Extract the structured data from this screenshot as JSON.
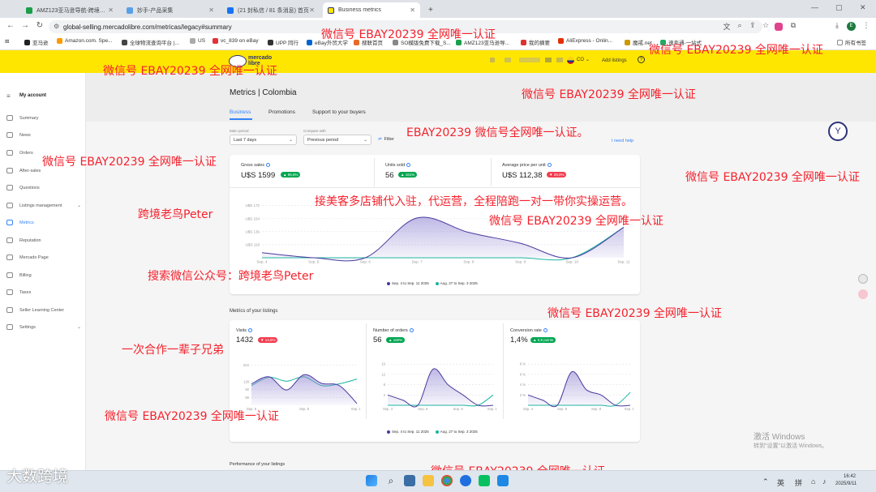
{
  "browser": {
    "tabs": [
      {
        "title": "AMZ123亚马逊导航-跨境电商",
        "color": "#1a9f4a"
      },
      {
        "title": "妙手-产品采集",
        "color": "#5aa0e8"
      },
      {
        "title": "(21 封私信 / 81 条消息) 首页",
        "color": "#1772f6"
      },
      {
        "title": "Business metrics",
        "color": "#ffe600"
      }
    ],
    "new_tab": "+",
    "url": "global-selling.mercadolibre.com/metricas/legacy#summary",
    "bookmarks": [
      "亚马逊",
      "Amazon.com. Spe...",
      "全球物流查询平台 |...",
      "US",
      "vc_839 on eBay",
      "UPP 同行",
      "eBay外贸大学",
      "搜联首页",
      "SO模版免费下载_S...",
      "AMZ123亚马逊导...",
      "我的摘要",
      "AliExpress - Onlin...",
      "魔戒.net",
      "速卖通-一站式"
    ],
    "bookmarks_right": "所有书签"
  },
  "header": {
    "logo_line1": "mercado",
    "logo_line2": "libre",
    "country": "CO",
    "add_listings": "Add listings"
  },
  "sidebar": {
    "title": "My account",
    "items": [
      {
        "label": "Summary"
      },
      {
        "label": "News"
      },
      {
        "label": "Orders"
      },
      {
        "label": "After-sales"
      },
      {
        "label": "Questions"
      },
      {
        "label": "Listings management"
      },
      {
        "label": "Metrics"
      },
      {
        "label": "Reputation"
      },
      {
        "label": "Mercado Page"
      },
      {
        "label": "Billing"
      },
      {
        "label": "Taxes"
      },
      {
        "label": "Seller Learning Center"
      },
      {
        "label": "Settings"
      }
    ]
  },
  "page": {
    "title": "Metrics | Colombia",
    "tabs": [
      "Business",
      "Promotions",
      "Support to your buyers"
    ]
  },
  "filters": {
    "main_period_label": "Main period",
    "main_period_value": "Last 7 days",
    "compare_label": "Compare with",
    "compare_value": "Previous period",
    "filter_label": "Filter",
    "need_help": "I need help"
  },
  "kpis": [
    {
      "label": "Gross sales",
      "value": "U$S 1599",
      "change": "▲ 86,8%",
      "direction": "up"
    },
    {
      "label": "Units sold",
      "value": "56",
      "change": "▲ 161%",
      "direction": "up"
    },
    {
      "label": "Average price per unit",
      "value": "U$S 112,38",
      "change": "▼ 29,0%",
      "direction": "down"
    }
  ],
  "listings": {
    "section_title": "Metrics of your listings",
    "cards": [
      {
        "label": "Visits",
        "value": "1432",
        "change": "▼ 14,5%",
        "direction": "down"
      },
      {
        "label": "Number of orders",
        "value": "56",
        "change": "▲ 160%",
        "direction": "up"
      },
      {
        "label": "Conversion rate",
        "value": "1,4%",
        "change": "▲ 0,8 points",
        "direction": "up"
      }
    ]
  },
  "performance_title": "Performance of your listings",
  "chart_data": [
    {
      "type": "area",
      "x": [
        "Sep. 4",
        "Sep. 5",
        "Sep. 6",
        "Sep. 7",
        "Sep. 8",
        "Sep. 9",
        "Sep. 10",
        "Sep. 11"
      ],
      "y_ticks": [
        "U$S 172",
        "U$S 154",
        "U$S 136",
        "U$S 118"
      ],
      "ylim": [
        100,
        175
      ],
      "series": [
        {
          "name": "Sep. 4 to Sep. 11 2025",
          "color": "#4a3a9e",
          "values": [
            107,
            100,
            100,
            155,
            135,
            120,
            100,
            142
          ]
        },
        {
          "name": "Aug. 27 to Sep. 3 2025",
          "color": "#1ab5a0",
          "values": [
            100,
            100,
            100,
            100,
            100,
            100,
            100,
            142
          ]
        }
      ]
    },
    {
      "type": "area",
      "x": [
        "Sep. 6",
        "Sep. 8",
        "Sep. 10"
      ],
      "y_ticks": [
        "204",
        "128",
        "92",
        "56"
      ],
      "ylim": [
        20,
        220
      ],
      "series": [
        {
          "name": "Sep. 4 to Sep. 11 2025",
          "color": "#4a3a9e",
          "values": [
            118,
            150,
            90,
            160,
            120,
            110,
            28
          ]
        },
        {
          "name": "Aug. 27 to Sep. 3 2025",
          "color": "#1ab5a0",
          "values": [
            110,
            148,
            130,
            150,
            110,
            118,
            140
          ]
        }
      ]
    },
    {
      "type": "area",
      "x": [
        "Sep. 4",
        "Sep. 6",
        "Sep. 8",
        "Sep. 10"
      ],
      "y_ticks": [
        "16",
        "12",
        "8",
        "4"
      ],
      "ylim": [
        0,
        17
      ],
      "series": [
        {
          "name": "Sep. 4 to Sep. 11 2025",
          "color": "#4a3a9e",
          "values": [
            4,
            2,
            0,
            14,
            8,
            4,
            0,
            0
          ]
        },
        {
          "name": "Aug. 27 to Sep. 3 2025",
          "color": "#1ab5a0",
          "values": [
            0,
            0,
            0,
            0,
            0,
            0,
            0,
            4
          ]
        }
      ]
    },
    {
      "type": "area",
      "x": [
        "Sep. 4",
        "Sep. 6",
        "Sep. 8",
        "Sep. 10"
      ],
      "y_ticks": [
        "8 %",
        "6 %",
        "4 %",
        "2 %"
      ],
      "ylim": [
        0,
        8.5
      ],
      "series": [
        {
          "name": "Sep. 4 to Sep. 11 2025",
          "color": "#4a3a9e",
          "values": [
            2,
            1,
            0,
            6.5,
            3,
            2,
            0,
            0
          ]
        },
        {
          "name": "Aug. 27 to Sep. 3 2025",
          "color": "#1ab5a0",
          "values": [
            0,
            0,
            0,
            0,
            0,
            0,
            0,
            2.5
          ]
        }
      ]
    }
  ],
  "watermarks": [
    "微信号 EBAY20239 全网唯一认证",
    "微信号 EBAY20239 全网唯一认证",
    "微信号 EBAY20239 全网唯一认证",
    "微信号 EBAY20239 全网唯一认证",
    "EBAY20239 微信号全网唯一认证。",
    "微信号 EBAY20239 全网唯一认证",
    "微信号 EBAY20239 全网唯一认证",
    "接美客多店铺代入驻，代运营，全程陪跑一对一带你实操运营。",
    "跨境老鸟Peter",
    "微信号 EBAY20239 全网唯一认证",
    "搜索微信公众号：跨境老鸟Peter",
    "微信号 EBAY20239 全网唯一认证",
    "一次合作一辈子兄弟",
    "微信号 EBAY20239 全网唯一认证",
    "微信号 EBAY20239 全网唯一认证"
  ],
  "os": {
    "activate_line1": "激活 Windows",
    "activate_line2": "转到\"设置\"以激活 Windows。",
    "brand": "大数跨境",
    "ime1": "英",
    "ime2": "拼",
    "time": "16:42",
    "date": "2025/9/11"
  }
}
